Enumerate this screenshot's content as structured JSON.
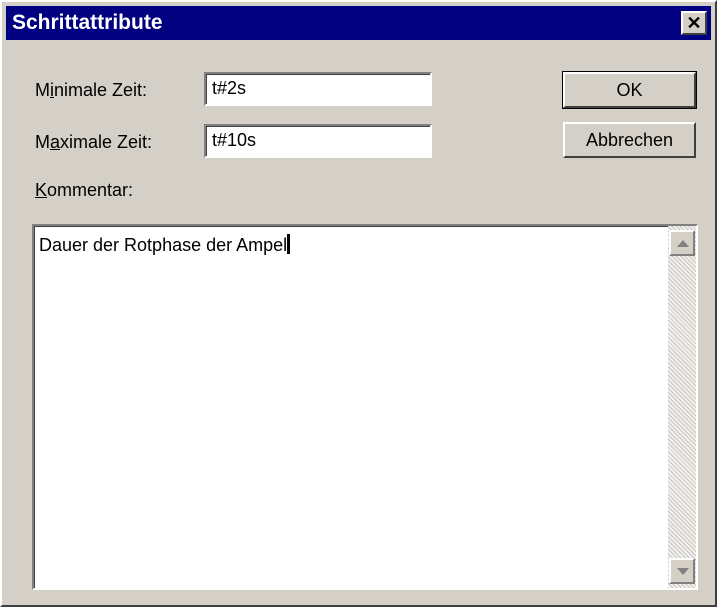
{
  "dialog": {
    "title": "Schrittattribute",
    "close_glyph": "✕"
  },
  "fields": {
    "min_time": {
      "label_pre": "M",
      "label_mnemonic": "i",
      "label_post": "nimale Zeit:",
      "value": "t#2s"
    },
    "max_time": {
      "label_pre": "M",
      "label_mnemonic": "a",
      "label_post": "ximale Zeit:",
      "value": "t#10s"
    }
  },
  "buttons": {
    "ok_label": "OK",
    "cancel_label": "Abbrechen"
  },
  "comment": {
    "label_mnemonic": "K",
    "label_post": "ommentar:",
    "value": "Dauer der Rotphase der Ampel"
  },
  "colors": {
    "titlebar": "#000080",
    "dialog_face": "#d4d0c8"
  }
}
